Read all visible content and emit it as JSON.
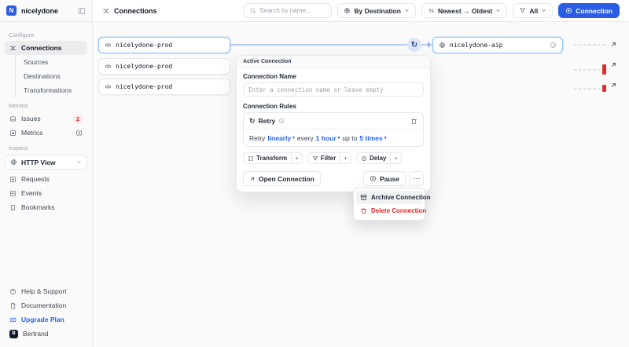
{
  "workspace": {
    "name": "nicelydone",
    "logo_letter": "N"
  },
  "topbar": {
    "page_title": "Connections",
    "search_placeholder": "Search by name...",
    "group_button": "By Destination",
    "sort_button": "Newest → Oldest",
    "filter_button": "All",
    "new_connection_button": "Connection"
  },
  "sidebar": {
    "sections": [
      {
        "label": "Configure",
        "items": [
          {
            "label": "Connections",
            "active": true
          },
          {
            "label": "Sources"
          },
          {
            "label": "Destinations"
          },
          {
            "label": "Transformations"
          }
        ]
      },
      {
        "label": "Monitor",
        "items": [
          {
            "label": "Issues",
            "badge": "2"
          },
          {
            "label": "Metrics"
          }
        ]
      },
      {
        "label": "Inspect",
        "items": [
          {
            "label": "HTTP View"
          },
          {
            "label": "Requests"
          },
          {
            "label": "Events"
          },
          {
            "label": "Bookmarks"
          }
        ]
      }
    ],
    "footer_items": [
      {
        "label": "Help & Support"
      },
      {
        "label": "Documentation"
      },
      {
        "label": "Upgrade Plan"
      },
      {
        "label": "Bertrand"
      }
    ]
  },
  "canvas": {
    "sources": [
      {
        "name": "nicelydone-prod"
      },
      {
        "name": "nicelydone-prod"
      },
      {
        "name": "nicelydone-prod"
      }
    ],
    "destination": {
      "name": "nicelydone-aip"
    }
  },
  "popover": {
    "header": "Active Connection",
    "name_label": "Connection Name",
    "name_placeholder": "Enter a connection name or leave empty",
    "rules_label": "Connection Rules",
    "retry_rule": {
      "title": "Retry",
      "word1": "Retry",
      "value1": "linearly",
      "word2": "every",
      "value2": "1 hour",
      "word3": "up to",
      "value3": "5 times"
    },
    "chips": [
      {
        "label": "Transform"
      },
      {
        "label": "Filter"
      },
      {
        "label": "Delay"
      }
    ],
    "open_button": "Open Connection",
    "pause_button": "Pause"
  },
  "context_menu": {
    "items": [
      {
        "label": "Archive Connection"
      },
      {
        "label": "Delete Connection",
        "danger": true
      }
    ]
  },
  "icons_text": {
    "retry": "↻",
    "more": "⋯",
    "plus": "+",
    "caret": "▾"
  },
  "colors": {
    "accent": "#2a5ce4",
    "link_blue": "#2563eb",
    "danger_red": "#dc2626",
    "selected_border": "#93c5fd",
    "badge_bg": "#fdeaea"
  }
}
